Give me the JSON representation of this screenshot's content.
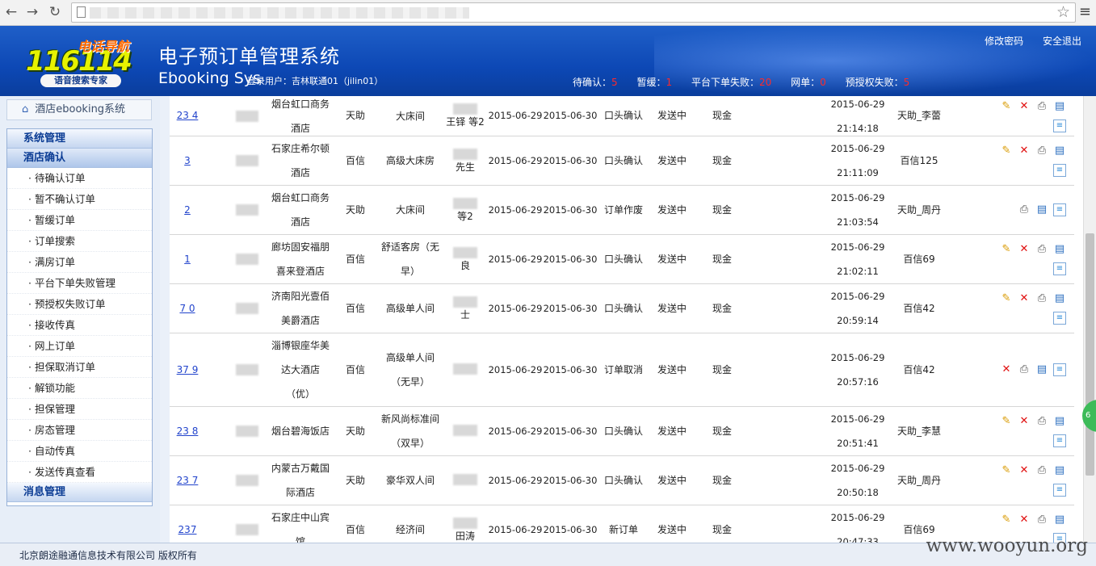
{
  "browser": {
    "back": "←",
    "forward": "→",
    "reload": "↻",
    "star": "☆",
    "menu": "≡"
  },
  "header": {
    "logo_number": "116114",
    "logo_tag": "电话导航",
    "logo_slogan": "语音搜索专家",
    "title": "电子预订单管理系统",
    "subtitle": "Ebooking Sys",
    "login_user": "登录用户：吉林联通01（jilin01）",
    "links": {
      "change_password": "修改密码",
      "logout": "安全退出"
    },
    "status": {
      "pending_label": "待确认：",
      "pending_count": "5",
      "paused_label": "暂缓：",
      "paused_count": "1",
      "platform_fail_label": "平台下单失败：",
      "platform_fail_count": "20",
      "web_label": "网单：",
      "web_count": "0",
      "preauth_fail_label": "预授权失败：",
      "preauth_fail_count": "5"
    }
  },
  "sidebar": {
    "home": "酒店ebooking系统",
    "groups": {
      "system": "系统管理",
      "hotel_confirm": "酒店确认",
      "message": "消息管理"
    },
    "items": [
      "待确认订单",
      "暂不确认订单",
      "暂缓订单",
      "订单搜索",
      "满房订单",
      "平台下单失败管理",
      "预授权失败订单",
      "接收传真",
      "网上订单",
      "担保取消订单",
      "解锁功能",
      "担保管理",
      "房态管理",
      "自动传真",
      "发送传真查看"
    ]
  },
  "orders": [
    {
      "id": "23  4",
      "hotel_l1": "烟台虹口商务",
      "hotel_l2": "酒店",
      "source": "天助",
      "room_l1": "大床间",
      "room_l2": "",
      "guest": "王铎 等2",
      "checkin": "2015-06-29",
      "checkout": "2015-06-30",
      "status": "口头确认",
      "send": "发送中",
      "pay": "现金",
      "date": "2015-06-29",
      "time": "21:14:18",
      "operator": "天助_李蕾",
      "acts": "full"
    },
    {
      "id": "3",
      "hotel_l1": "石家庄希尔顿",
      "hotel_l2": "酒店",
      "source": "百信",
      "room_l1": "高级大床房",
      "room_l2": "",
      "guest": "先生",
      "checkin": "2015-06-29",
      "checkout": "2015-06-30",
      "status": "口头确认",
      "send": "发送中",
      "pay": "现金",
      "date": "2015-06-29",
      "time": "21:11:09",
      "operator": "百信125",
      "acts": "full"
    },
    {
      "id": "2",
      "hotel_l1": "烟台虹口商务",
      "hotel_l2": "酒店",
      "source": "天助",
      "room_l1": "大床间",
      "room_l2": "",
      "guest": "等2",
      "checkin": "2015-06-29",
      "checkout": "2015-06-30",
      "status": "订单作废",
      "send": "发送中",
      "pay": "现金",
      "date": "2015-06-29",
      "time": "21:03:54",
      "operator": "天助_周丹",
      "acts": "print"
    },
    {
      "id": "1",
      "hotel_l1": "廊坊固安福朋",
      "hotel_l2": "喜来登酒店",
      "source": "百信",
      "room_l1": "舒适客房（无",
      "room_l2": "早）",
      "guest": "良",
      "checkin": "2015-06-29",
      "checkout": "2015-06-30",
      "status": "口头确认",
      "send": "发送中",
      "pay": "现金",
      "date": "2015-06-29",
      "time": "21:02:11",
      "operator": "百信69",
      "acts": "full"
    },
    {
      "id": "7  0",
      "hotel_l1": "济南阳光壹佰",
      "hotel_l2": "美爵酒店",
      "source": "百信",
      "room_l1": "高级单人间",
      "room_l2": "",
      "guest": "士",
      "checkin": "2015-06-29",
      "checkout": "2015-06-30",
      "status": "口头确认",
      "send": "发送中",
      "pay": "现金",
      "date": "2015-06-29",
      "time": "20:59:14",
      "operator": "百信42",
      "acts": "full"
    },
    {
      "id": "37  9",
      "hotel_l1": "淄博银座华美",
      "hotel_l2": "达大酒店",
      "hotel_l3": "（优）",
      "source": "百信",
      "room_l1": "高级单人间",
      "room_l2": "（无早）",
      "guest": "",
      "checkin": "2015-06-29",
      "checkout": "2015-06-30",
      "status": "订单取消",
      "send": "发送中",
      "pay": "现金",
      "date": "2015-06-29",
      "time": "20:57:16",
      "operator": "百信42",
      "acts": "cancel"
    },
    {
      "id": "23  8",
      "hotel_l1": "烟台碧海饭店",
      "hotel_l2": "",
      "source": "天助",
      "room_l1": "新风尚标准间",
      "room_l2": "（双早）",
      "guest": "",
      "checkin": "2015-06-29",
      "checkout": "2015-06-30",
      "status": "口头确认",
      "send": "发送中",
      "pay": "现金",
      "date": "2015-06-29",
      "time": "20:51:41",
      "operator": "天助_李慧",
      "acts": "full"
    },
    {
      "id": "23  7",
      "hotel_l1": "内蒙古万戴国",
      "hotel_l2": "际酒店",
      "source": "天助",
      "room_l1": "豪华双人间",
      "room_l2": "",
      "guest": "",
      "checkin": "2015-06-29",
      "checkout": "2015-06-30",
      "status": "口头确认",
      "send": "发送中",
      "pay": "现金",
      "date": "2015-06-29",
      "time": "20:50:18",
      "operator": "天助_周丹",
      "acts": "full"
    },
    {
      "id": "237",
      "hotel_l1": "石家庄中山宾",
      "hotel_l2": "馆",
      "source": "百信",
      "room_l1": "经济间",
      "room_l2": "",
      "guest": "田涛",
      "checkin": "2015-06-29",
      "checkout": "2015-06-30",
      "status": "新订单",
      "send": "发送中",
      "pay": "现金",
      "date": "2015-06-29",
      "time": "20:47:33",
      "operator": "百信69",
      "acts": "full"
    }
  ],
  "footer": {
    "copyright": "北京朗途融通信息技术有限公司 版权所有",
    "watermark": "www.wooyun.org"
  },
  "colors": {
    "header_blue": "#0d48b5",
    "accent_red": "#ff2a2a",
    "menu_blue": "#0b3c94"
  }
}
